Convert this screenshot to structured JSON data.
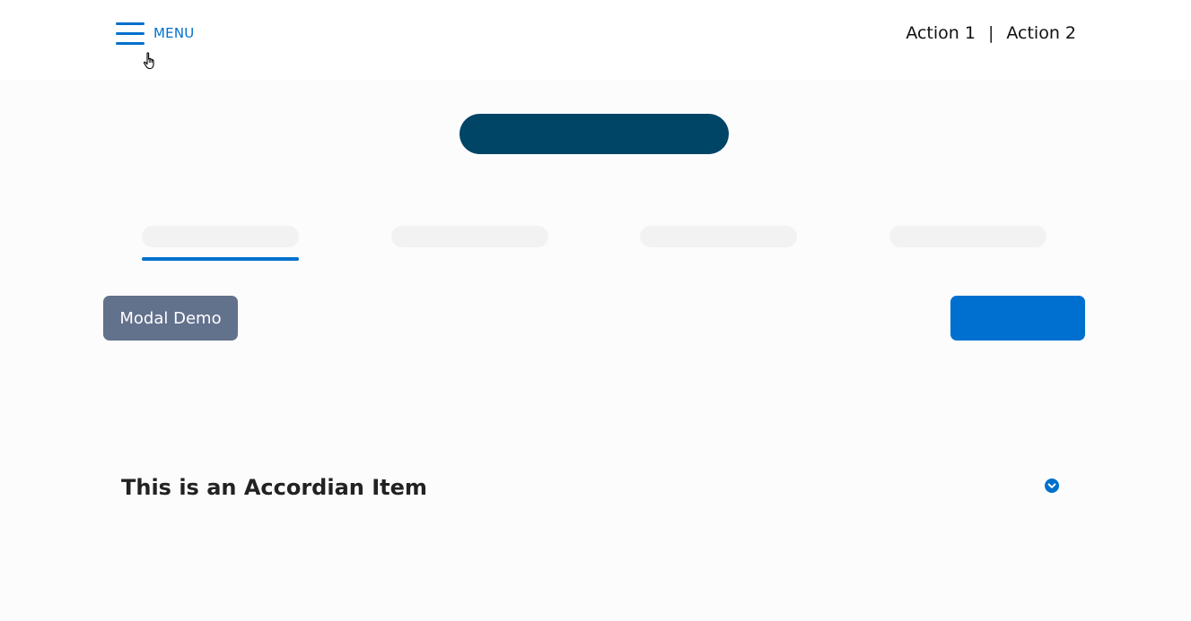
{
  "header": {
    "menu_label": "MENU",
    "actions": [
      {
        "label": "Action 1"
      },
      {
        "label": "Action 2"
      }
    ],
    "separator": "|"
  },
  "buttons": {
    "modal_demo_label": "Modal Demo",
    "primary_label": ""
  },
  "accordion": {
    "title": "This is an Accordian Item",
    "icon": "chevron-down-circle-icon"
  },
  "tabs": {
    "count": 4,
    "active_index": 0
  },
  "colors": {
    "accent": "#0070cc",
    "hero": "#004466",
    "modal_button": "#62718c",
    "primary_button": "#0070d0",
    "skeleton": "#f2f2f2"
  }
}
